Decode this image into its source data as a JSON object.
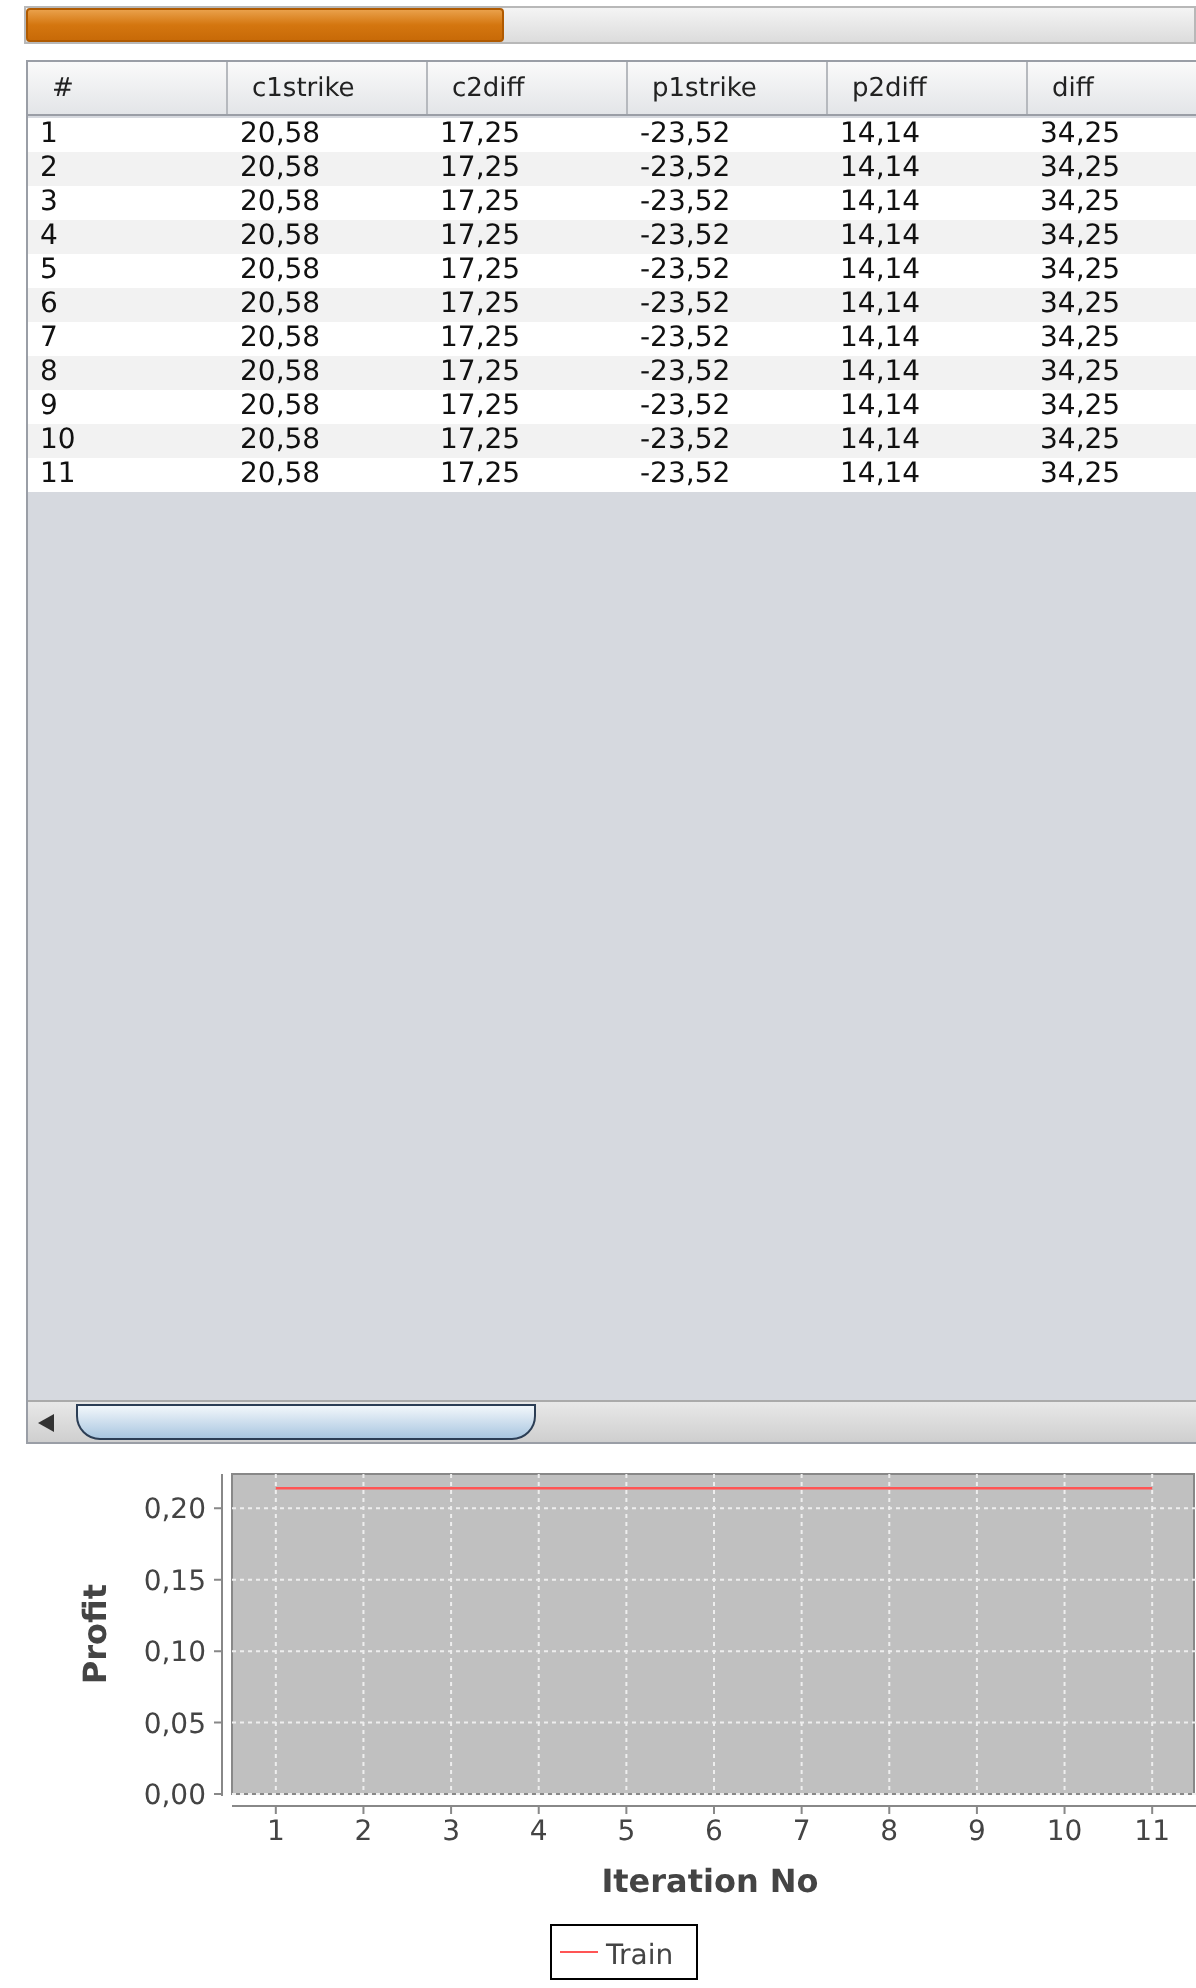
{
  "progress": {
    "level": 0.41
  },
  "table": {
    "columns": [
      "#",
      "c1strike",
      "c2diff",
      "p1strike",
      "p2diff",
      "diff"
    ],
    "rows": [
      [
        "1",
        "20,58",
        "17,25",
        "-23,52",
        "14,14",
        "34,25"
      ],
      [
        "2",
        "20,58",
        "17,25",
        "-23,52",
        "14,14",
        "34,25"
      ],
      [
        "3",
        "20,58",
        "17,25",
        "-23,52",
        "14,14",
        "34,25"
      ],
      [
        "4",
        "20,58",
        "17,25",
        "-23,52",
        "14,14",
        "34,25"
      ],
      [
        "5",
        "20,58",
        "17,25",
        "-23,52",
        "14,14",
        "34,25"
      ],
      [
        "6",
        "20,58",
        "17,25",
        "-23,52",
        "14,14",
        "34,25"
      ],
      [
        "7",
        "20,58",
        "17,25",
        "-23,52",
        "14,14",
        "34,25"
      ],
      [
        "8",
        "20,58",
        "17,25",
        "-23,52",
        "14,14",
        "34,25"
      ],
      [
        "9",
        "20,58",
        "17,25",
        "-23,52",
        "14,14",
        "34,25"
      ],
      [
        "10",
        "20,58",
        "17,25",
        "-23,52",
        "14,14",
        "34,25"
      ],
      [
        "11",
        "20,58",
        "17,25",
        "-23,52",
        "14,14",
        "34,25"
      ]
    ]
  },
  "chart": {
    "chart_data": {
      "type": "line",
      "xlabel": "Iteration No",
      "ylabel": "Profit",
      "x": [
        1,
        2,
        3,
        4,
        5,
        6,
        7,
        8,
        9,
        10,
        11
      ],
      "series": [
        {
          "name": "Train",
          "color": "#ff5555",
          "values": [
            0.214,
            0.214,
            0.214,
            0.214,
            0.214,
            0.214,
            0.214,
            0.214,
            0.214,
            0.214,
            0.214
          ]
        }
      ],
      "xlim": [
        0.5,
        11.5
      ],
      "ylim": [
        0,
        0.224
      ],
      "grid": true,
      "xticks": [
        1,
        2,
        3,
        4,
        5,
        6,
        7,
        8,
        9,
        10,
        11
      ],
      "yticks": [
        {
          "value": 0,
          "label": "0,00"
        },
        {
          "value": 0.05,
          "label": "0,05"
        },
        {
          "value": 0.1,
          "label": "0,10"
        },
        {
          "value": 0.15,
          "label": "0,15"
        },
        {
          "value": 0.2,
          "label": "0,20"
        }
      ]
    }
  }
}
